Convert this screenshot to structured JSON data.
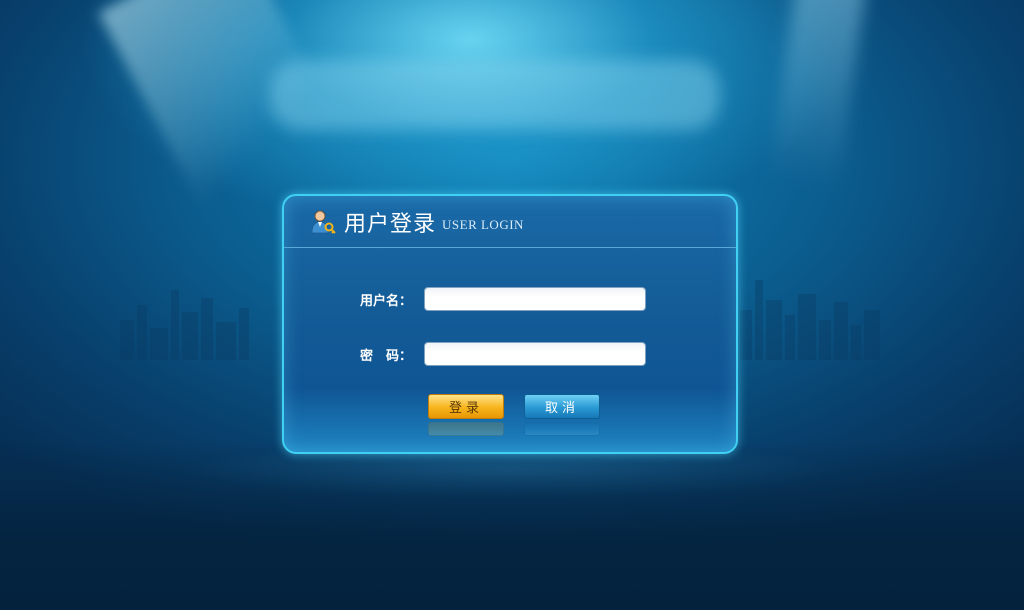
{
  "login": {
    "title": "用户登录",
    "subtitle": "USER LOGIN",
    "username_label": "用户名：",
    "username_value": "",
    "password_label": "密　码：",
    "password_value": "",
    "login_button": "登录",
    "cancel_button": "取消"
  },
  "colors": {
    "panel_border": "#3fd0f4",
    "login_button": "#f7b41c",
    "cancel_button": "#2a9ad4"
  },
  "icons": {
    "header_icon": "user-key-icon"
  }
}
